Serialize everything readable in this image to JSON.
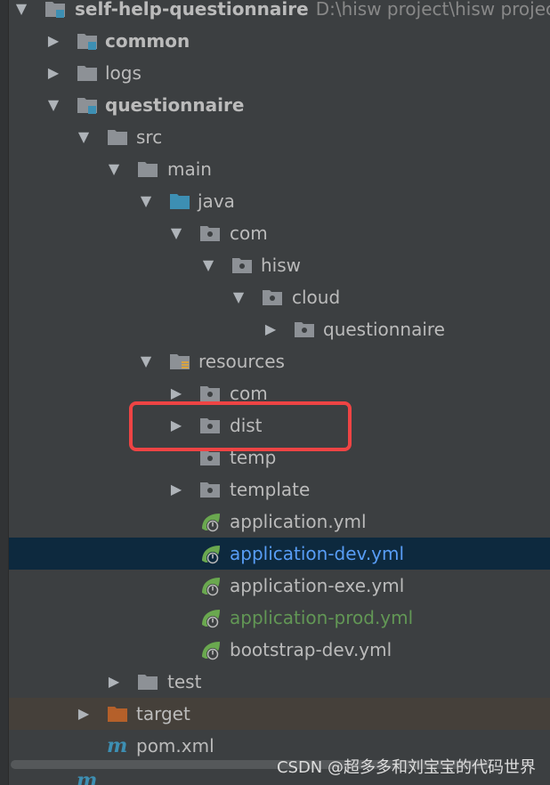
{
  "tree": {
    "root": {
      "label": "self-help-questionnaire",
      "path": "D:\\hisw project\\hisw project"
    },
    "common": "common",
    "logs": "logs",
    "questionnaire": "questionnaire",
    "src": "src",
    "main": "main",
    "java": "java",
    "com": "com",
    "hisw": "hisw",
    "cloud": "cloud",
    "questionnaire_pkg": "questionnaire",
    "resources": "resources",
    "res_com": "com",
    "dist": "dist",
    "temp": "temp",
    "template": "template",
    "app_yml": "application.yml",
    "app_dev_yml": "application-dev.yml",
    "app_exe_yml": "application-exe.yml",
    "app_prod_yml": "application-prod.yml",
    "bootstrap_dev_yml": "bootstrap-dev.yml",
    "test": "test",
    "target": "target",
    "pom": "pom.xml"
  },
  "watermark": "CSDN @超多多和刘宝宝的代码世界",
  "colors": {
    "background": "#3c3f41",
    "selection": "#0d293e",
    "folder": "#8d9196",
    "source_folder": "#3d8fb3",
    "excluded_folder": "#b5602a",
    "spring_leaf": "#6aa84f",
    "highlight": "#ee4444"
  }
}
